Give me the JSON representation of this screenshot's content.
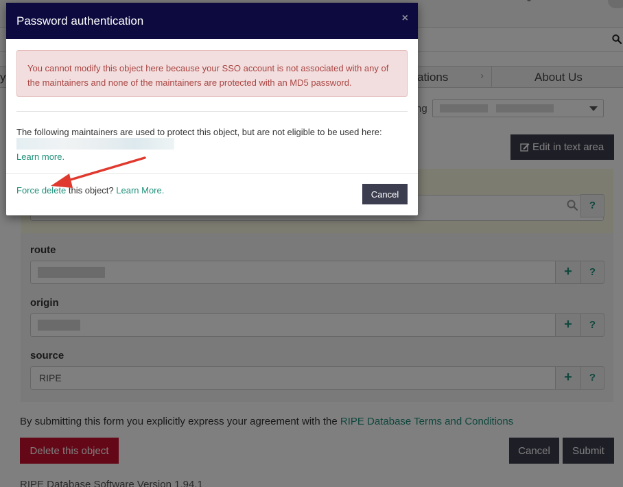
{
  "nav": {
    "partial_left": "y",
    "partial_locations": "ations",
    "chevron": "›",
    "about": "About Us"
  },
  "maintainer_select": {
    "partial_label": "ng"
  },
  "toolbar": {
    "edit_label": "Edit in text area"
  },
  "form": {
    "fields": [
      {
        "label": "route",
        "value": ""
      },
      {
        "label": "origin",
        "value": ""
      },
      {
        "label": "source",
        "value": "RIPE"
      }
    ],
    "add_symbol": "+",
    "help_symbol": "?"
  },
  "agreement": {
    "text": "By submitting this form you explicitly express your agreement with the ",
    "link": "RIPE Database Terms and Conditions"
  },
  "actions": {
    "delete_label": "Delete this object",
    "cancel_label": "Cancel",
    "submit_label": "Submit"
  },
  "footer": {
    "version": "RIPE Database Software Version 1.94.1"
  },
  "modal": {
    "title": "Password authentication",
    "close_symbol": "×",
    "alert_text": "You cannot modify this object here because your SSO account is not associated with any of the maintainers and none of the maintainers are protected with an MD5 password.",
    "maintainers_text": "The following maintainers are used to protect this object, but are not eligible to be used here:",
    "learn_more": "Learn more.",
    "force_delete_link": "Force delete",
    "force_delete_text": " this object? ",
    "learn_more_2": "Learn More.",
    "cancel_label": "Cancel"
  },
  "colors": {
    "modal_header": "#0c0a3e",
    "accent_link": "#1f8f7a",
    "danger": "#c8102e",
    "dark_button": "#3c3d4f",
    "alert_bg": "#f2dede",
    "alert_text": "#a94442",
    "annotation_arrow": "#e03a2f"
  }
}
